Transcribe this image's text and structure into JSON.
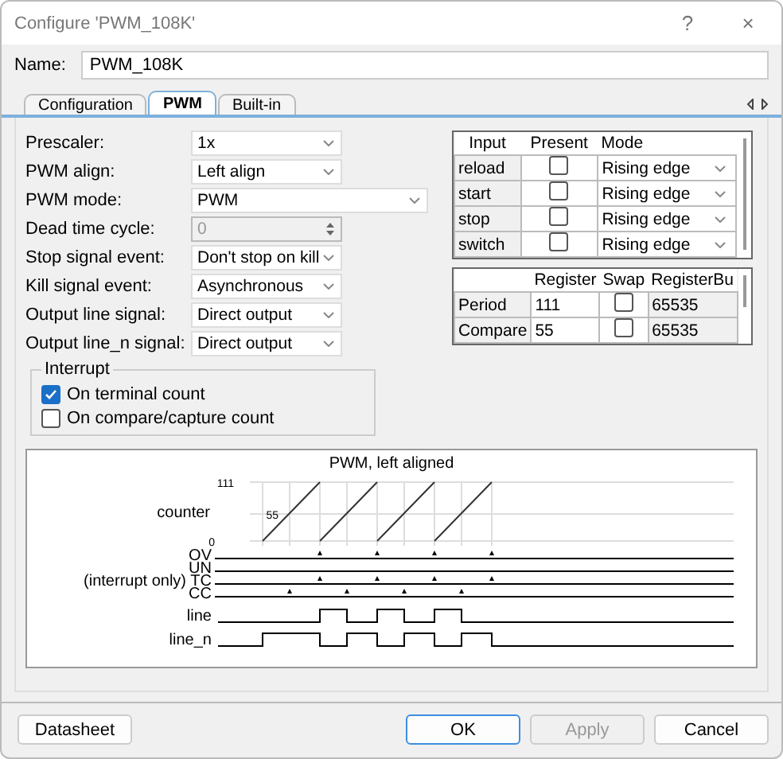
{
  "window": {
    "title": "Configure 'PWM_108K'",
    "help": "?",
    "close": "×"
  },
  "name_field": {
    "label": "Name:",
    "value": "PWM_108K"
  },
  "tabs": [
    {
      "label": "Configuration",
      "selected": false
    },
    {
      "label": "PWM",
      "selected": true
    },
    {
      "label": "Built-in",
      "selected": false
    }
  ],
  "settings": [
    {
      "label": "Prescaler:",
      "value": "1x",
      "kind": "select",
      "disabled": false
    },
    {
      "label": "PWM align:",
      "value": "Left align",
      "kind": "select",
      "disabled": false
    },
    {
      "label": "PWM mode:",
      "value": "PWM",
      "kind": "select-wide",
      "disabled": false
    },
    {
      "label": "Dead time cycle:",
      "value": "0",
      "kind": "spinner",
      "disabled": true
    },
    {
      "label": "Stop signal event:",
      "value": "Don't stop on kill",
      "kind": "select",
      "disabled": false
    },
    {
      "label": "Kill signal event:",
      "value": "Asynchronous",
      "kind": "select",
      "disabled": false
    },
    {
      "label": "Output line signal:",
      "value": "Direct output",
      "kind": "select",
      "disabled": false
    },
    {
      "label": "Output line_n signal:",
      "value": "Direct output",
      "kind": "select",
      "disabled": false
    }
  ],
  "interrupt": {
    "title": "Interrupt",
    "options": [
      {
        "label": "On terminal count",
        "checked": true
      },
      {
        "label": "On compare/capture count",
        "checked": false
      }
    ]
  },
  "inputs_table": {
    "columns": [
      "Input",
      "Present",
      "Mode"
    ],
    "rows": [
      {
        "input": "reload",
        "present": false,
        "mode": "Rising edge"
      },
      {
        "input": "start",
        "present": false,
        "mode": "Rising edge"
      },
      {
        "input": "stop",
        "present": false,
        "mode": "Rising edge"
      },
      {
        "input": "switch",
        "present": false,
        "mode": "Rising edge"
      }
    ]
  },
  "registers_table": {
    "columns": [
      "Register",
      "Swap",
      "RegisterBu"
    ],
    "rows": [
      {
        "name": "Period",
        "register": "111",
        "swap": false,
        "buffer": "65535"
      },
      {
        "name": "Compare",
        "register": "55",
        "swap": false,
        "buffer": "65535"
      }
    ]
  },
  "diagram": {
    "title": "PWM, left aligned",
    "counter_label": "counter",
    "ticks": [
      "111",
      "55",
      "0"
    ],
    "events": [
      "OV",
      "UN",
      "TC",
      "CC"
    ],
    "interrupt_note": "(interrupt only)",
    "outputs": [
      "line",
      "line_n"
    ]
  },
  "buttons": [
    {
      "label": "Datasheet",
      "kind": "plain",
      "disabled": false
    },
    {
      "label": "OK",
      "kind": "default",
      "disabled": false
    },
    {
      "label": "Apply",
      "kind": "plain",
      "disabled": true
    },
    {
      "label": "Cancel",
      "kind": "plain",
      "disabled": false
    }
  ]
}
